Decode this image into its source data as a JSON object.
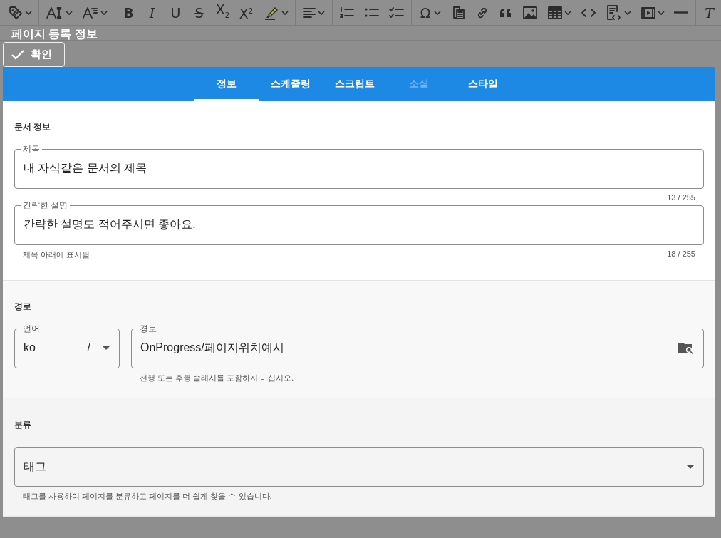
{
  "toolbar": {
    "groups": [
      [
        {
          "kind": "icon",
          "dropdown": true
        }
      ],
      [
        {
          "kind": "icon",
          "dropdown": true
        },
        {
          "kind": "icon",
          "dropdown": true
        }
      ],
      [
        {
          "kind": "bold",
          "text": "B",
          "dropdown": false
        },
        {
          "kind": "italic",
          "text": "I",
          "dropdown": false
        },
        {
          "kind": "underline",
          "text": "U",
          "dropdown": false
        },
        {
          "kind": "strike",
          "text": "S",
          "dropdown": false
        },
        {
          "kind": "glyph",
          "text": "X$_{2}$",
          "dropdown": false
        },
        {
          "kind": "glyph",
          "text": "X$^{2}$",
          "dropdown": false
        },
        {
          "kind": "icon",
          "dropdown": true
        }
      ],
      [
        {
          "kind": "icon",
          "dropdown": true
        }
      ],
      [
        {
          "kind": "icon",
          "dropdown": false
        },
        {
          "kind": "icon",
          "dropdown": false
        },
        {
          "kind": "icon",
          "dropdown": false
        }
      ],
      [
        {
          "kind": "glyph",
          "text": "Ω",
          "dropdown": true
        },
        {
          "kind": "icon",
          "dropdown": false
        },
        {
          "kind": "icon",
          "dropdown": false
        },
        {
          "kind": "icon",
          "dropdown": false
        },
        {
          "kind": "icon",
          "dropdown": false
        },
        {
          "kind": "icon",
          "dropdown": true
        },
        {
          "kind": "icon",
          "dropdown": false
        },
        {
          "kind": "icon",
          "dropdown": true
        },
        {
          "kind": "icon",
          "dropdown": true
        },
        {
          "kind": "icon",
          "dropdown": false
        }
      ],
      [
        {
          "kind": "italic",
          "text": "T",
          "dropdown": false
        }
      ]
    ]
  },
  "dialog": {
    "title": "페이지 등록 정보",
    "confirm_button": "확인"
  },
  "tabs": [
    {
      "label": "정보",
      "selected": true,
      "disabled": false
    },
    {
      "label": "스케줄링",
      "selected": false,
      "disabled": false
    },
    {
      "label": "스크립트",
      "selected": false,
      "disabled": false
    },
    {
      "label": "소셜",
      "selected": false,
      "disabled": true
    },
    {
      "label": "스타일",
      "selected": false,
      "disabled": false
    }
  ],
  "sections": [
    {
      "title": "문서 정보",
      "fields": [
        {
          "kind": "text",
          "label": "제목",
          "value": "내 자식같은 문서의 제목",
          "counter": "13 / 255"
        },
        {
          "kind": "text",
          "label": "간략한 설명",
          "value": "간략한 설명도 적어주시면 좋아요.",
          "hint": "제목 아래에 표시됨",
          "counter": "18 / 255"
        }
      ]
    },
    {
      "title": "경로",
      "fields": [
        {
          "kind": "language",
          "label": "언어",
          "value": "ko",
          "suffix": "/"
        },
        {
          "kind": "path",
          "label": "경로",
          "value": "OnProgress/페이지위치예시",
          "hint": "선행 또는 후행 슬래시를 포함하지 마십시오."
        }
      ]
    },
    {
      "title": "분류",
      "fields": [
        {
          "kind": "select",
          "placeholder": "태그",
          "hint": "태그를 사용하여 페이지를 분류하고 페이지를 더 쉽게 찾을 수 있습니다."
        }
      ]
    }
  ]
}
